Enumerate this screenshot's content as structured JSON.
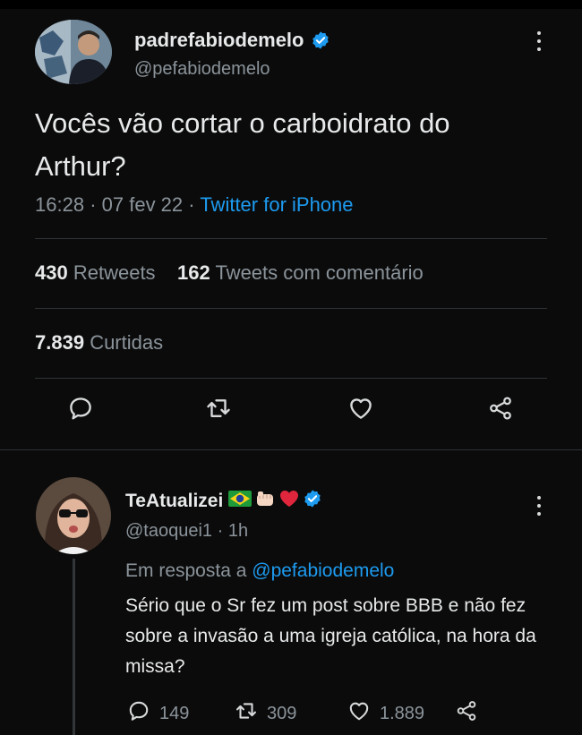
{
  "tweet": {
    "name": "padrefabiodemelo",
    "handle": "@pefabiodemelo",
    "text": "Vocês vão cortar o carboidrato do Arthur?",
    "time": "16:28",
    "date": "07 fev 22",
    "source": "Twitter for iPhone",
    "retweets_count": "430",
    "retweets_label": "Retweets",
    "quotes_count": "162",
    "quotes_label": "Tweets com comentário",
    "likes_count": "7.839",
    "likes_label": "Curtidas"
  },
  "reply": {
    "name": "TeAtualizei",
    "handle": "@taoquei1",
    "age": "1h",
    "replying_prefix": "Em resposta a",
    "replying_to": "@pefabiodemelo",
    "text": "Sério que o Sr fez um post sobre BBB e não fez sobre a invasão a uma igreja católica, na hora da missa?",
    "reply_count": "149",
    "retweet_count": "309",
    "like_count": "1.889"
  },
  "colors": {
    "background": "#0b0b0b",
    "link": "#1d9bf0",
    "secondary_text": "#8b949b",
    "verified": "#1d9bf0"
  },
  "icons": [
    "reply-icon",
    "retweet-icon",
    "like-icon",
    "share-icon",
    "verified-badge-icon",
    "more-icon",
    "brazil-flag-icon",
    "fist-icon",
    "heart-icon"
  ]
}
